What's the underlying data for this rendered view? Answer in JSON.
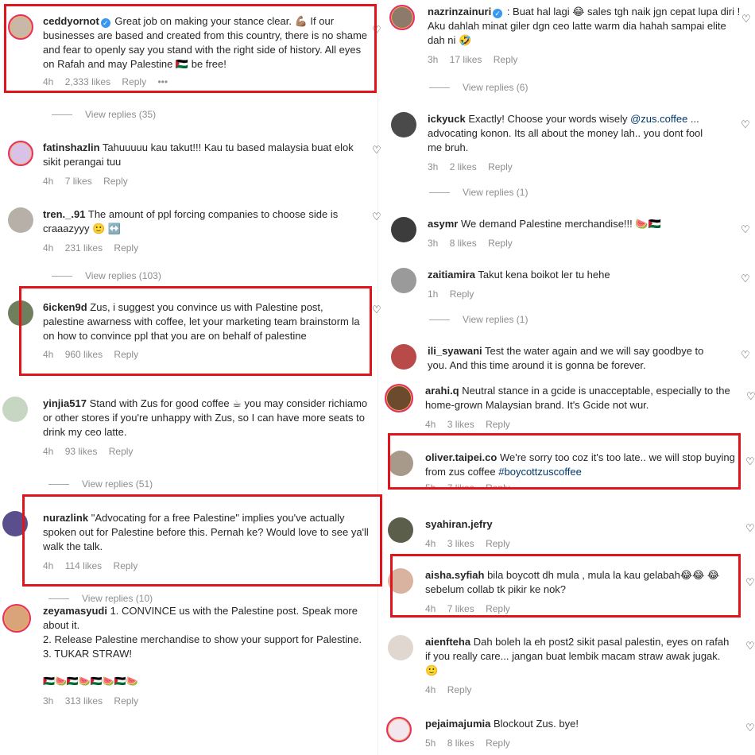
{
  "left": [
    {
      "user": "ceddyornot",
      "verified": true,
      "text": "Great job on making your stance clear. 💪🏽 If our businesses are based and created from this country, there is no shame and fear to openly say you stand with the right side of history. All eyes on Rafah and may Palestine 🇵🇸 be free!",
      "time": "4h",
      "likes": "2,333 likes",
      "reply": "Reply",
      "more": "•••",
      "replies": "View replies (35)",
      "avatar": "#c9b8a8"
    },
    {
      "user": "fatinshazlin",
      "text": "Tahuuuuu kau takut!!! Kau tu based malaysia buat elok sikit perangai tuu",
      "time": "4h",
      "likes": "7 likes",
      "reply": "Reply",
      "avatar": "#d8c2e8"
    },
    {
      "user": "tren._.91",
      "text": "The amount of ppl forcing companies to choose side is craaazyyy 🙂 ↔️",
      "time": "4h",
      "likes": "231 likes",
      "reply": "Reply",
      "replies": "View replies (103)",
      "avatar": "#b7b0a8"
    },
    {
      "user": "6icken9d",
      "text": "Zus, i suggest you convince us with Palestine post, palestine awarness with coffee, let your marketing team brainstorm la on how to convince ppl that you are on behalf of palestine",
      "time": "4h",
      "likes": "960 likes",
      "reply": "Reply",
      "avatar": "#6f7e5d"
    },
    {
      "user": "yinjia517",
      "text": "Stand with Zus for good coffee ☕ you may consider richiamo or other stores if you're unhappy with Zus, so I can have more seats to drink my ceo latte.",
      "time": "4h",
      "likes": "93 likes",
      "reply": "Reply",
      "replies": "View replies (51)",
      "avatar": "#c7d6c2"
    },
    {
      "user": "nurazlink",
      "text": "\"Advocating for a free Palestine\" implies you've actually spoken out for Palestine before this. Pernah ke? Would love to see ya'll walk the talk.",
      "time": "4h",
      "likes": "114 likes",
      "reply": "Reply",
      "replies": "View replies (10)",
      "avatar": "#5a4e8c"
    },
    {
      "user": "zeyamasyudi",
      "text": "1. CONVINCE us with the Palestine post. Speak more about it.\n2. Release Palestine merchandise to show your support for Palestine.\n3. TUKAR STRAW!",
      "text2": "🇵🇸🍉🇵🇸🍉🇵🇸🍉🇵🇸🍉",
      "time": "3h",
      "likes": "313 likes",
      "reply": "Reply",
      "avatar": "#d9a47a"
    }
  ],
  "right": [
    {
      "user": "nazrinzainuri",
      "verified": true,
      "text": ": Buat hal lagi 😂 sales tgh naik jgn cepat lupa diri ! Aku dahlah minat giler dgn ceo latte warm dia hahah sampai elite dah ni 🤣",
      "time": "3h",
      "likes": "17 likes",
      "reply": "Reply",
      "replies": "View replies (6)",
      "avatar": "#8c7b6a"
    },
    {
      "user": "ickyuck",
      "text_pre": "Exactly! Choose your words wisely ",
      "mention": "@zus.coffee",
      "text_post": " ... advocating konon. Its all about the money lah.. you dont fool me bruh.",
      "time": "3h",
      "likes": "2 likes",
      "reply": "Reply",
      "replies": "View replies (1)",
      "avatar": "#4a4a4a"
    },
    {
      "user": "asymr",
      "text": "We demand Palestine merchandise!!! 🍉🇵🇸",
      "time": "3h",
      "likes": "8 likes",
      "reply": "Reply",
      "avatar": "#3c3c3c"
    },
    {
      "user": "zaitiamira",
      "text": "Takut kena boikot ler tu hehe",
      "time": "1h",
      "reply": "Reply",
      "replies": "View replies (1)",
      "avatar": "#9a9a9a"
    },
    {
      "user": "ili_syawani",
      "text": "Test the water again and we will say goodbye to you. And this time around it is gonna be forever.",
      "avatar": "#b84a4a"
    },
    {
      "user": "arahi.q",
      "text": "Neutral stance in a gcide is unacceptable, especially to the home-grown Malaysian brand. It's Gcide not wur.",
      "time": "4h",
      "likes": "3 likes",
      "reply": "Reply",
      "avatar": "#6b4a2e"
    },
    {
      "user": "oliver.taipei.co",
      "text_pre": "We're sorry too coz it's too late.. we will stop buying from zus coffee ",
      "mention": "#boycottzuscoffee",
      "time": "5h",
      "likes": "7 likes",
      "reply": "Reply",
      "avatar": "#a89a8a"
    },
    {
      "user": "syahiran.jefry",
      "time": "4h",
      "likes": "3 likes",
      "reply": "Reply",
      "avatar": "#5b5e4a"
    },
    {
      "user": "aisha.syfiah",
      "text": "bila boycott dh mula , mula la kau gelabah😂😂 😂sebelum collab tk pikir ke nok?",
      "time": "4h",
      "likes": "7 likes",
      "reply": "Reply",
      "avatar": "#d9b3a0"
    },
    {
      "user": "aienfteha",
      "text": "Dah boleh la eh post2 sikit pasal palestin, eyes on rafah if you really care... jangan buat lembik macam straw awak jugak. 🙂",
      "time": "4h",
      "reply": "Reply",
      "avatar": "#e0d8d0"
    },
    {
      "user": "pejaimajumia",
      "text": "Blockout Zus. bye!",
      "time": "5h",
      "likes": "8 likes",
      "reply": "Reply",
      "avatar": "#f3e6ee"
    }
  ]
}
